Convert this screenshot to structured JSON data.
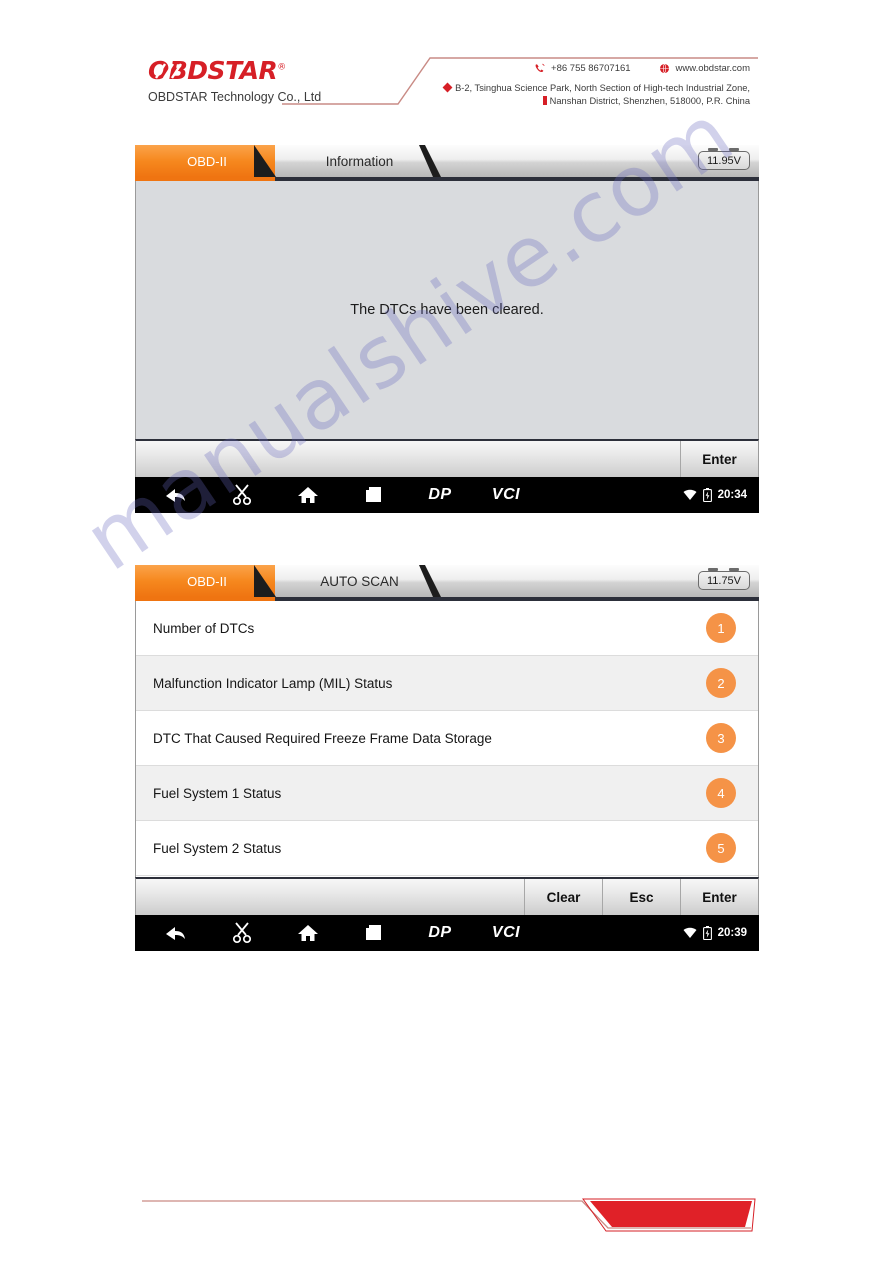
{
  "header": {
    "logo_text": "OBDSTAR",
    "logo_reg": "®",
    "company": "OBDSTAR Technology Co., Ltd",
    "phone": "+86 755 86707161",
    "website": "www.obdstar.com",
    "address_line1": "B-2, Tsinghua Science Park, North Section of High-tech Industrial Zone,",
    "address_line2": "Nanshan District, Shenzhen, 518000, P.R.   China"
  },
  "watermark": {
    "text": "manualshive.com"
  },
  "screenshot_one": {
    "tabs": [
      {
        "label": "OBD-II",
        "active": true
      },
      {
        "label": "Information",
        "active": false
      }
    ],
    "voltage": "11.95V",
    "message": "The DTCs have been cleared.",
    "buttons": [
      {
        "label": "Enter"
      }
    ],
    "navbar": {
      "icons": [
        "back-icon",
        "scissors-icon",
        "home-icon",
        "recent-apps-icon"
      ],
      "brand_dp": "DP",
      "brand_vci": "VCI",
      "time": "20:34"
    }
  },
  "screenshot_two": {
    "tabs": [
      {
        "label": "OBD-II",
        "active": true
      },
      {
        "label": "AUTO SCAN",
        "active": false
      }
    ],
    "voltage": "11.75V",
    "list": [
      {
        "label": "Number of DTCs",
        "badge": "1"
      },
      {
        "label": "Malfunction Indicator Lamp (MIL) Status",
        "badge": "2"
      },
      {
        "label": "DTC That Caused Required Freeze Frame Data Storage",
        "badge": "3"
      },
      {
        "label": "Fuel System 1 Status",
        "badge": "4"
      },
      {
        "label": "Fuel System 2 Status",
        "badge": "5"
      }
    ],
    "buttons": [
      {
        "label": "Clear"
      },
      {
        "label": "Esc"
      },
      {
        "label": "Enter"
      }
    ],
    "navbar": {
      "icons": [
        "back-icon",
        "scissors-icon",
        "home-icon",
        "recent-apps-icon"
      ],
      "brand_dp": "DP",
      "brand_vci": "VCI",
      "time": "20:39"
    }
  },
  "colors": {
    "brand_red": "#d61f26",
    "accent_orange": "#ef7411",
    "badge_orange": "#f59347"
  }
}
